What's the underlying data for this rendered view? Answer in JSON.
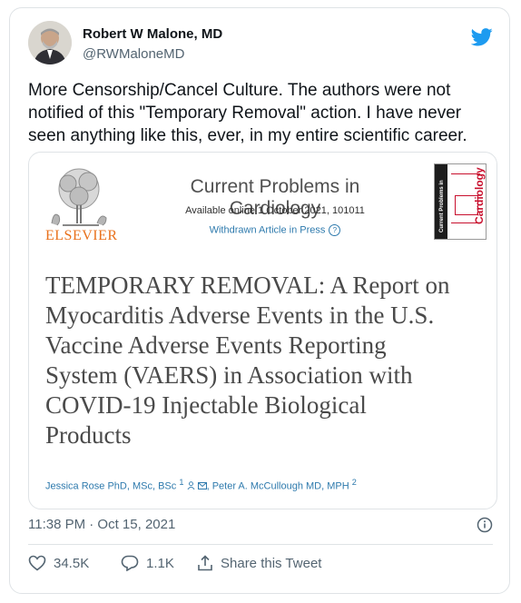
{
  "author": {
    "name": "Robert W Malone, MD",
    "handle": "@RWMaloneMD"
  },
  "tweet": {
    "text_lines": [
      "More Censorship/Cancel Culture. The authors were not",
      "notified of this \"Temporary Removal\" action.  I have never",
      "seen anything like this, ever, in my entire scientific career."
    ],
    "timestamp": "11:38 PM · Oct 15, 2021"
  },
  "embed": {
    "publisher": "ELSEVIER",
    "journal": "Current Problems in Cardiology",
    "available": "Available online 1 October 2021, 101011",
    "withdrawn": "Withdrawn Article in Press",
    "cover_title": "Cardiology",
    "cover_side": "Current Problems in",
    "article_title_lines": [
      "TEMPORARY REMOVAL: A Report on",
      "Myocarditis Adverse Events in the U.S.",
      "Vaccine Adverse Events Reporting",
      "System (VAERS) in Association with",
      "COVID-19 Injectable Biological",
      "Products"
    ],
    "author1": "Jessica Rose PhD, MSc, BSc",
    "author1_sup": "1",
    "author2": "Peter A. McCullough MD, MPH",
    "author2_sup": "2"
  },
  "actions": {
    "likes": "34.5K",
    "replies": "1.1K",
    "share": "Share this Tweet"
  },
  "colors": {
    "twitter_blue": "#1d9bf0",
    "elsevier_orange": "#e9711c",
    "link_blue": "#2e7aad",
    "muted": "#536471"
  },
  "icons": [
    "twitter-bird-icon",
    "info-icon",
    "heart-icon",
    "reply-icon",
    "share-icon",
    "question-icon",
    "person-icon",
    "email-icon"
  ]
}
